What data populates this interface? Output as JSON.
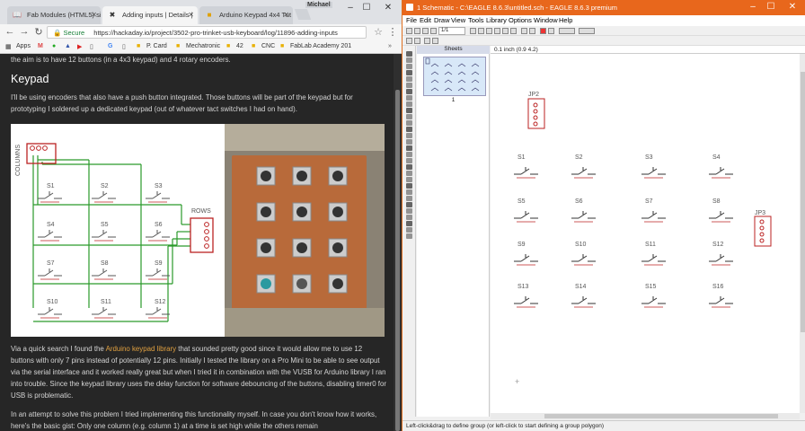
{
  "chrome": {
    "tabs": [
      {
        "label": "Fab Modules (HTML5) si",
        "icon": "book-icon"
      },
      {
        "label": "Adding inputs | Details |",
        "icon": "hackaday-icon"
      },
      {
        "label": "Arduino Keypad 4x4 Tut",
        "icon": "instructables-icon"
      }
    ],
    "profile": "Michael",
    "secure_label": "Secure",
    "url": "https://hackaday.io/project/3502-pro-trinket-usb-keyboard/log/11896-adding-inputs",
    "bookmarks": [
      "Apps",
      "M",
      "",
      "",
      "",
      "",
      "G",
      "",
      "P. Card",
      "Mechatronic",
      "42",
      "CNC",
      "FabLab Academy 201"
    ]
  },
  "article": {
    "intro": "the aim is to have 12 buttons (in a 4x3 keypad) and 4 rotary encoders.",
    "heading": "Keypad",
    "p1": "I'll be using encoders that also have a push button integrated. Those buttons will be part of the keypad but for prototyping I soldered up a dedicated keypad (out of whatever tact switches I had on hand).",
    "schematic": {
      "columns_label": "COLUMNS",
      "rows_label": "ROWS",
      "switches": [
        "S1",
        "S2",
        "S3",
        "S4",
        "S5",
        "S6",
        "S7",
        "S8",
        "S9",
        "S10",
        "S11",
        "S12"
      ]
    },
    "p2_before_link": "Via a quick search I found the ",
    "p2_link": "Arduino keypad library",
    "p2_after_link": " that sounded pretty good since it would allow me to use 12 buttons with only 7 pins instead of potentially 12 pins. Initially I tested the library on a Pro Mini to be able to see output via the serial interface and it worked really great but when I tried it in combination with the VUSB for Arduino library I ran into trouble. Since the keypad library uses the delay function for software debouncing of the buttons, disabling timer0 for USB is problematic.",
    "p3": "In an attempt to solve this problem I tried implementing this functionality myself. In case you don't know how it works, here's the basic gist: Only one column (e.g. column 1) at a time is set high while the others remain"
  },
  "eagle": {
    "title": "1 Schematic - C:\\EAGLE 8.6.3\\untitled.sch - EAGLE 8.6.3 premium",
    "menu": [
      "File",
      "Edit",
      "Draw",
      "View",
      "Tools",
      "Library",
      "Options",
      "Window",
      "Help"
    ],
    "sheet_select": "1/1",
    "sheets_header": "Sheets",
    "sheet_number": "1",
    "coord": "0.1 inch (0.9 4.2)",
    "parts": {
      "jp2": "JP2",
      "jp3": "JP3",
      "switches": [
        "S1",
        "S2",
        "S3",
        "S4",
        "S5",
        "S6",
        "S7",
        "S8",
        "S9",
        "S10",
        "S11",
        "S12",
        "S13",
        "S14",
        "S15",
        "S16"
      ]
    },
    "status": "Left-click&drag to define group (or left-click to start defining a group polygon)"
  }
}
